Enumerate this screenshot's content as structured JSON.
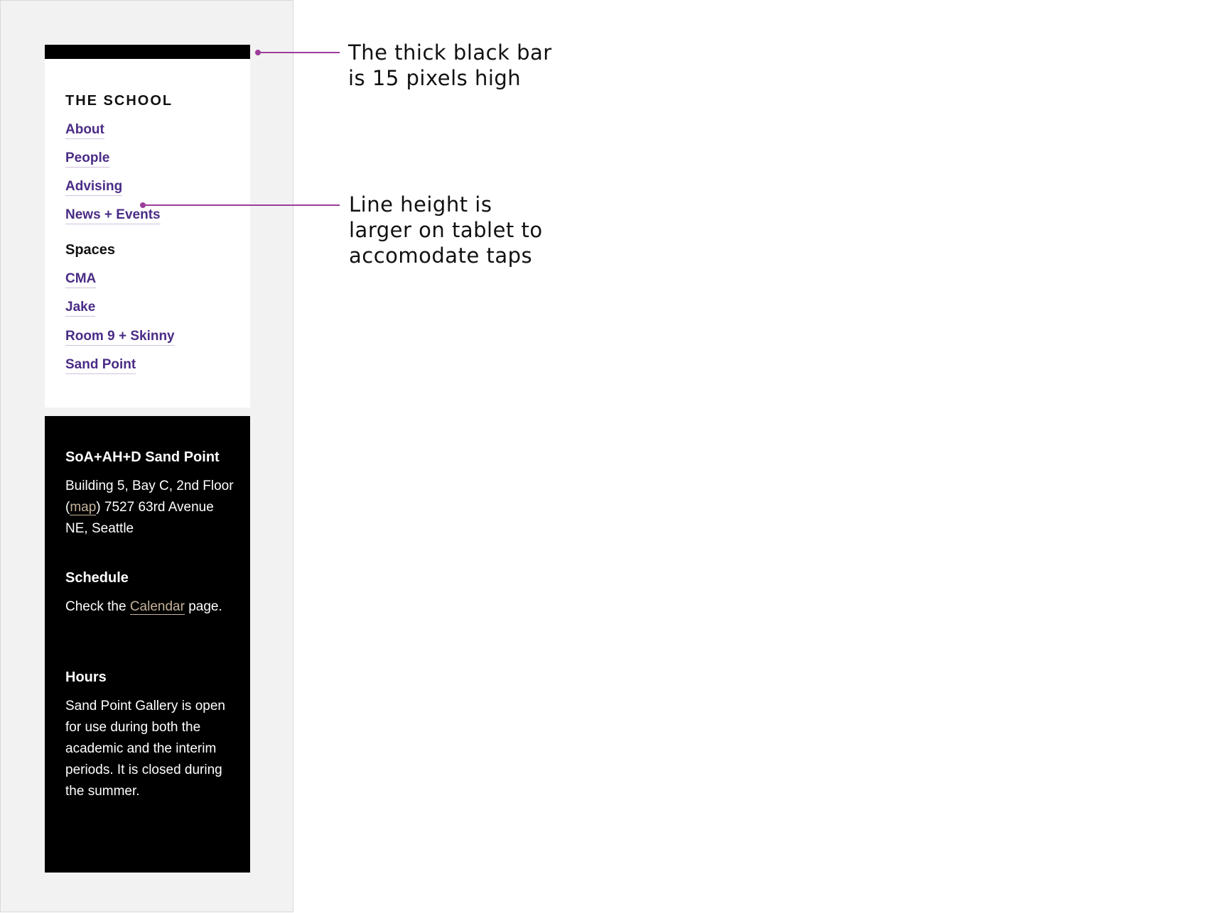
{
  "colors": {
    "link": "#4a2c86",
    "footer_link": "#c5b39a",
    "bar": "#000000",
    "annotation": "#9c3d9c"
  },
  "nav": {
    "heading": "THE SCHOOL",
    "links": [
      "About",
      "People",
      "Advising",
      "News + Events"
    ],
    "spaces_heading": "Spaces",
    "spaces_links": [
      "CMA",
      "Jake",
      "Room 9 + Skinny",
      "Sand Point"
    ]
  },
  "info": {
    "location": {
      "title": "SoA+AH+D Sand Point",
      "text_before": "Building 5, Bay C, 2nd Floor (",
      "link": "map",
      "text_after": ") 7527 63rd Avenue NE, Seattle"
    },
    "schedule": {
      "title": "Schedule",
      "text_before": "Check the ",
      "link": "Calendar",
      "text_after": " page."
    },
    "hours": {
      "title": "Hours",
      "text": "Sand Point Gallery is open for use during both the academic and the interim periods. It is closed during the summer."
    }
  },
  "annotations": {
    "bar_note_line1": "The thick black bar",
    "bar_note_line2": "is 15 pixels high",
    "line_height_note_line1": "Line height is",
    "line_height_note_line2": "larger on tablet to",
    "line_height_note_line3": "accomodate taps"
  }
}
